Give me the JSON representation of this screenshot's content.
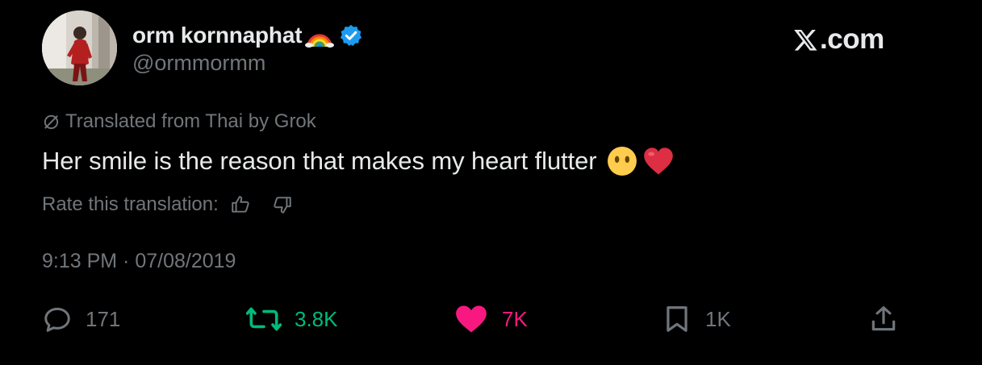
{
  "author": {
    "display_name": "orm kornnaphat",
    "handle": "@ormmormm",
    "avatar": "avatar-photo",
    "name_emoji": "rainbow-icon",
    "verified_badge": "verified-badge-icon",
    "verified_color": "#1d9bf0"
  },
  "brand": {
    "label": ".com",
    "logo": "x-logo-icon"
  },
  "translation": {
    "notice": "Translated from Thai by Grok",
    "icon": "globe-slash-icon",
    "rate_label": "Rate this translation:",
    "rate_up_icon": "thumbs-up-icon",
    "rate_down_icon": "thumbs-down-icon"
  },
  "tweet": {
    "text": "Her smile is the reason that makes my heart flutter",
    "emojis": [
      "face-without-mouth-emoji",
      "red-heart-emoji"
    ],
    "timestamp": "9:13 PM · 07/08/2019"
  },
  "actions": {
    "reply": {
      "count": "171",
      "icon": "reply-icon",
      "color": "#71767b"
    },
    "retweet": {
      "count": "3.8K",
      "icon": "retweet-icon",
      "color": "#00ba7c"
    },
    "like": {
      "count": "7K",
      "icon": "heart-icon",
      "color": "#f91880"
    },
    "bookmark": {
      "count": "1K",
      "icon": "bookmark-icon",
      "color": "#71767b"
    },
    "share": {
      "icon": "share-icon",
      "color": "#71767b"
    }
  },
  "colors": {
    "background": "#000000",
    "primary_text": "#e7e9ea",
    "secondary_text": "#71767b"
  }
}
